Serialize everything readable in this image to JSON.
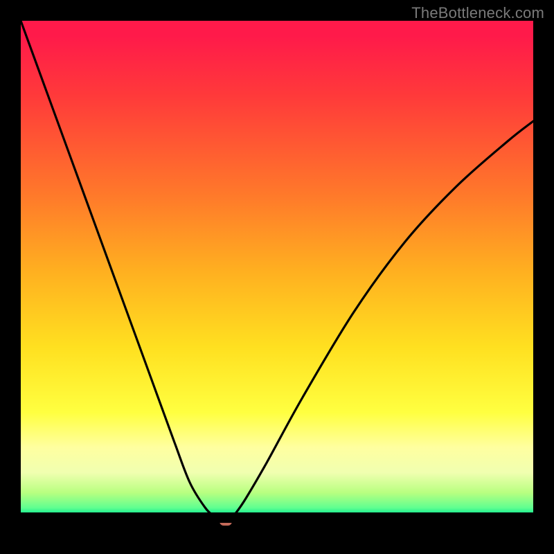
{
  "watermark": "TheBottleneck.com",
  "chart_data": {
    "type": "line",
    "title": "",
    "xlabel": "",
    "ylabel": "",
    "xlim": [
      0,
      100
    ],
    "ylim": [
      0,
      100
    ],
    "series": [
      {
        "name": "curve",
        "x": [
          0,
          5,
          10,
          15,
          20,
          25,
          30,
          33,
          36,
          38,
          39,
          40,
          41,
          42,
          44,
          48,
          55,
          65,
          75,
          85,
          95,
          100
        ],
        "values": [
          100,
          86,
          72,
          58,
          44,
          30,
          16,
          8,
          3,
          1,
          0,
          0,
          1,
          2,
          5,
          12,
          25,
          42,
          56,
          67,
          76,
          80
        ]
      }
    ],
    "marker": {
      "x": 40,
      "y": 0,
      "color": "#c46a5a",
      "shape": "rounded-rect"
    },
    "gradient_stops": [
      {
        "pos": 0,
        "color": "#ff1a4a"
      },
      {
        "pos": 35,
        "color": "#ff7a2a"
      },
      {
        "pos": 65,
        "color": "#ffe020"
      },
      {
        "pos": 90,
        "color": "#f0ffb0"
      },
      {
        "pos": 100,
        "color": "#00d090"
      }
    ]
  }
}
